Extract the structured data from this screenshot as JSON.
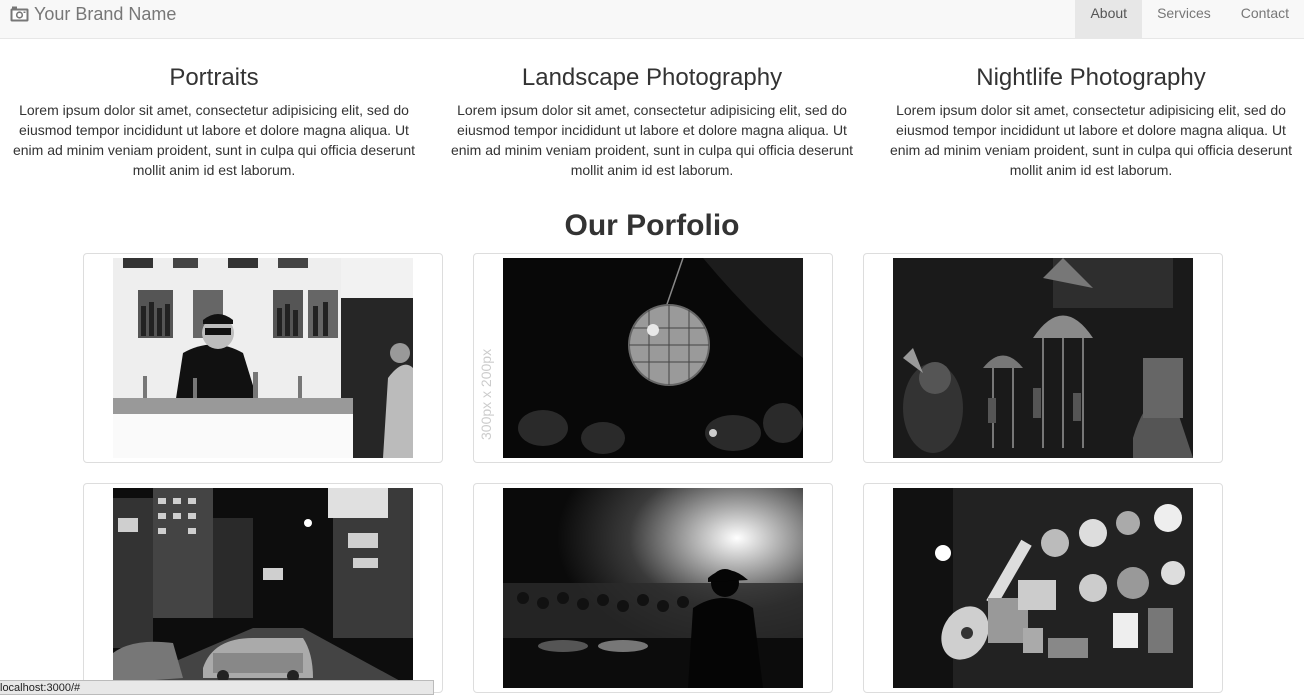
{
  "navbar": {
    "brand": "Your Brand Name",
    "brand_icon": "camera-icon",
    "links": [
      {
        "label": "About",
        "active": true
      },
      {
        "label": "Services",
        "active": false
      },
      {
        "label": "Contact",
        "active": false
      }
    ]
  },
  "features": [
    {
      "title": "Portraits",
      "text": "Lorem ipsum dolor sit amet, consectetur adipisicing elit, sed do eiusmod tempor incididunt ut labore et dolore magna aliqua. Ut enim ad minim veniam proident, sunt in culpa qui officia deserunt mollit anim id est laborum."
    },
    {
      "title": "Landscape Photography",
      "text": "Lorem ipsum dolor sit amet, consectetur adipisicing elit, sed do eiusmod tempor incididunt ut labore et dolore magna aliqua. Ut enim ad minim veniam proident, sunt in culpa qui officia deserunt mollit anim id est laborum."
    },
    {
      "title": "Nightlife Photography",
      "text": "Lorem ipsum dolor sit amet, consectetur adipisicing elit, sed do eiusmod tempor incididunt ut labore et dolore magna aliqua. Ut enim ad minim veniam proident, sunt in culpa qui officia deserunt mollit anim id est laborum."
    }
  ],
  "portfolio": {
    "title": "Our Porfolio",
    "items": [
      {
        "subject": "bartender"
      },
      {
        "subject": "disco-ball",
        "placeholder_label": "300px x 200px"
      },
      {
        "subject": "bar-interior"
      },
      {
        "subject": "city-street"
      },
      {
        "subject": "dj-crowd"
      },
      {
        "subject": "wall-signs"
      }
    ]
  },
  "status_bar": {
    "url": "localhost:3000/#"
  },
  "colors": {
    "navbar_bg": "#f8f8f8",
    "nav_active_bg": "#e7e7e7",
    "nav_text": "#777777",
    "heading_text": "#333333",
    "thumbnail_border": "#dddddd"
  }
}
